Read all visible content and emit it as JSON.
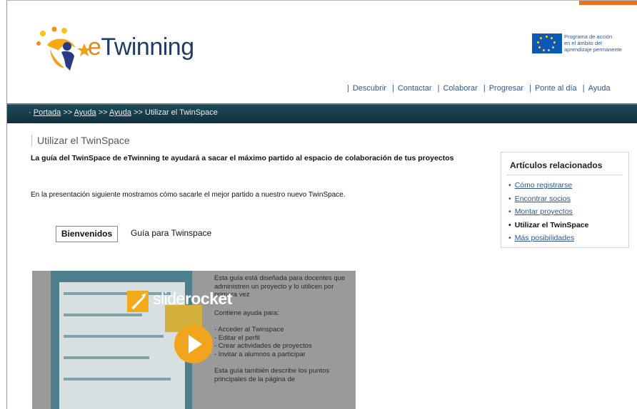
{
  "logo": {
    "brand_e": "e",
    "brand_rest": "Twinning"
  },
  "eu": {
    "line1": "Programa de acción",
    "line2": "en el ámbito del",
    "line3": "aprendizaje permanente"
  },
  "topnav": [
    "Descubrir",
    "Contactar",
    "Colaborar",
    "Progresar",
    "Ponte al día",
    "Ayuda"
  ],
  "breadcrumb": {
    "item1": "Portada",
    "sep": ">>",
    "item2": "Ayuda",
    "item3": "Ayuda",
    "current": "Utilizar el TwinSpace"
  },
  "page": {
    "title": "Utilizar el TwinSpace",
    "lead": "La guía del TwinSpace de eTwinning te ayudará a sacar el máximo partido al espacio de colaboración de tus proyectos",
    "intro": "En la presentación siguiente mostramos cómo sacarle el mejor partido a nuestro nuevo TwinSpace."
  },
  "tabs": {
    "active": "Bienvenidos",
    "other": "Guía para Twinspace"
  },
  "slide": {
    "logo_light": "slide",
    "logo_bold": "rocket",
    "p1": "Esta guía está diseñada para docentes que administren un proyecto y lo utilicen por primera vez",
    "p2": "Contiene ayuda para:",
    "b1": "- Acceder al Twinspace",
    "b2": "- Editar el perfil",
    "b3": "- Crear actividades de proyectos",
    "b4": "- Invitar a alumnos a participar",
    "p3": "Esta guía también describe los puntos principales de la página de"
  },
  "related": {
    "title": "Artículos relacionados",
    "items": [
      "Cómo registrarse",
      "Encontrar socios",
      "Montar proyectos",
      "Utilizar el TwinSpace",
      "Más posibilidades"
    ]
  },
  "colors": {
    "accent_orange": "#e8731f",
    "nav_bar": "#1e4a58",
    "link_blue": "#2c5597",
    "player_yellow": "#f0a51c"
  }
}
